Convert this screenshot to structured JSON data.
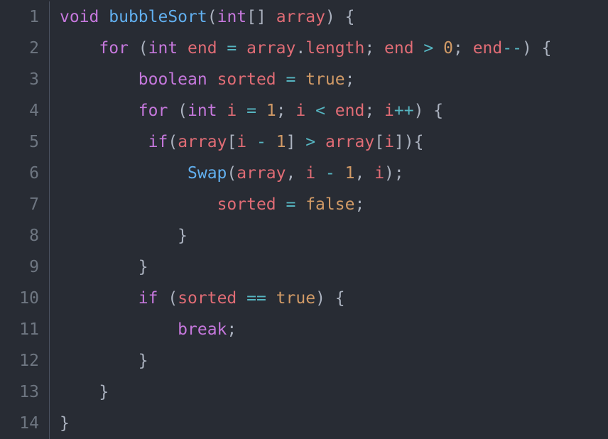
{
  "editor": {
    "language": "java",
    "lines": [
      {
        "n": 1,
        "indent": "",
        "tokens": [
          {
            "t": "void ",
            "c": "kw"
          },
          {
            "t": "bubbleSort",
            "c": "fn"
          },
          {
            "t": "(",
            "c": "punc"
          },
          {
            "t": "int",
            "c": "type"
          },
          {
            "t": "[] ",
            "c": "punc"
          },
          {
            "t": "array",
            "c": "var"
          },
          {
            "t": ") {",
            "c": "punc"
          }
        ]
      },
      {
        "n": 2,
        "indent": "    ",
        "tokens": [
          {
            "t": "for ",
            "c": "kw"
          },
          {
            "t": "(",
            "c": "punc"
          },
          {
            "t": "int ",
            "c": "type"
          },
          {
            "t": "end ",
            "c": "var"
          },
          {
            "t": "= ",
            "c": "op"
          },
          {
            "t": "array",
            "c": "var"
          },
          {
            "t": ".",
            "c": "punc"
          },
          {
            "t": "length",
            "c": "prop"
          },
          {
            "t": "; ",
            "c": "punc"
          },
          {
            "t": "end ",
            "c": "var"
          },
          {
            "t": "> ",
            "c": "op"
          },
          {
            "t": "0",
            "c": "num"
          },
          {
            "t": "; ",
            "c": "punc"
          },
          {
            "t": "end",
            "c": "var"
          },
          {
            "t": "--",
            "c": "op"
          },
          {
            "t": ") {",
            "c": "punc"
          }
        ]
      },
      {
        "n": 3,
        "indent": "        ",
        "tokens": [
          {
            "t": "boolean ",
            "c": "type"
          },
          {
            "t": "sorted ",
            "c": "var"
          },
          {
            "t": "= ",
            "c": "op"
          },
          {
            "t": "true",
            "c": "bool"
          },
          {
            "t": ";",
            "c": "punc"
          }
        ]
      },
      {
        "n": 4,
        "indent": "        ",
        "tokens": [
          {
            "t": "for ",
            "c": "kw"
          },
          {
            "t": "(",
            "c": "punc"
          },
          {
            "t": "int ",
            "c": "type"
          },
          {
            "t": "i ",
            "c": "var"
          },
          {
            "t": "= ",
            "c": "op"
          },
          {
            "t": "1",
            "c": "num"
          },
          {
            "t": "; ",
            "c": "punc"
          },
          {
            "t": "i ",
            "c": "var"
          },
          {
            "t": "< ",
            "c": "op"
          },
          {
            "t": "end",
            "c": "var"
          },
          {
            "t": "; ",
            "c": "punc"
          },
          {
            "t": "i",
            "c": "var"
          },
          {
            "t": "++",
            "c": "op"
          },
          {
            "t": ") {",
            "c": "punc"
          }
        ]
      },
      {
        "n": 5,
        "indent": "         ",
        "tokens": [
          {
            "t": "if",
            "c": "kw"
          },
          {
            "t": "(",
            "c": "punc"
          },
          {
            "t": "array",
            "c": "var"
          },
          {
            "t": "[",
            "c": "punc"
          },
          {
            "t": "i ",
            "c": "var"
          },
          {
            "t": "- ",
            "c": "op"
          },
          {
            "t": "1",
            "c": "num"
          },
          {
            "t": "] ",
            "c": "punc"
          },
          {
            "t": "> ",
            "c": "op"
          },
          {
            "t": "array",
            "c": "var"
          },
          {
            "t": "[",
            "c": "punc"
          },
          {
            "t": "i",
            "c": "var"
          },
          {
            "t": "]){",
            "c": "punc"
          }
        ]
      },
      {
        "n": 6,
        "indent": "             ",
        "tokens": [
          {
            "t": "Swap",
            "c": "fn"
          },
          {
            "t": "(",
            "c": "punc"
          },
          {
            "t": "array",
            "c": "var"
          },
          {
            "t": ", ",
            "c": "punc"
          },
          {
            "t": "i ",
            "c": "var"
          },
          {
            "t": "- ",
            "c": "op"
          },
          {
            "t": "1",
            "c": "num"
          },
          {
            "t": ", ",
            "c": "punc"
          },
          {
            "t": "i",
            "c": "var"
          },
          {
            "t": ");",
            "c": "punc"
          }
        ]
      },
      {
        "n": 7,
        "indent": "                ",
        "tokens": [
          {
            "t": "sorted ",
            "c": "var"
          },
          {
            "t": "= ",
            "c": "op"
          },
          {
            "t": "false",
            "c": "bool"
          },
          {
            "t": ";",
            "c": "punc"
          }
        ]
      },
      {
        "n": 8,
        "indent": "            ",
        "tokens": [
          {
            "t": "}",
            "c": "punc"
          }
        ]
      },
      {
        "n": 9,
        "indent": "        ",
        "tokens": [
          {
            "t": "}",
            "c": "punc"
          }
        ]
      },
      {
        "n": 10,
        "indent": "        ",
        "tokens": [
          {
            "t": "if ",
            "c": "kw"
          },
          {
            "t": "(",
            "c": "punc"
          },
          {
            "t": "sorted ",
            "c": "var"
          },
          {
            "t": "== ",
            "c": "op"
          },
          {
            "t": "true",
            "c": "bool"
          },
          {
            "t": ") {",
            "c": "punc"
          }
        ]
      },
      {
        "n": 11,
        "indent": "            ",
        "tokens": [
          {
            "t": "break",
            "c": "kw"
          },
          {
            "t": ";",
            "c": "punc"
          }
        ]
      },
      {
        "n": 12,
        "indent": "        ",
        "tokens": [
          {
            "t": "}",
            "c": "punc"
          }
        ]
      },
      {
        "n": 13,
        "indent": "    ",
        "tokens": [
          {
            "t": "}",
            "c": "punc"
          }
        ]
      },
      {
        "n": 14,
        "indent": "",
        "tokens": [
          {
            "t": "}",
            "c": "punc"
          }
        ]
      }
    ]
  }
}
